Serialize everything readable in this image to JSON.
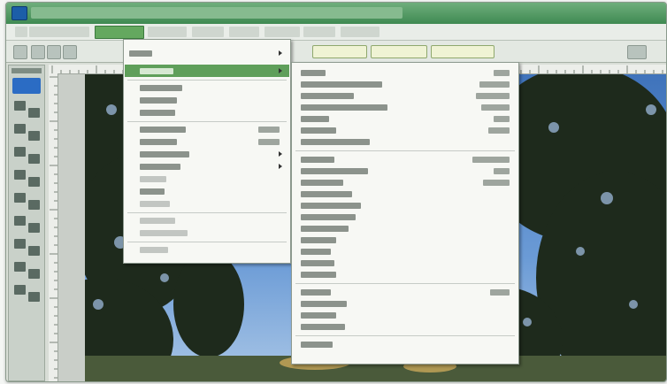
{
  "window": {
    "title": ""
  },
  "menubar": {
    "items": [
      {
        "label": "",
        "active": false
      },
      {
        "label": "",
        "active": false
      },
      {
        "label": "",
        "active": true
      },
      {
        "label": "",
        "active": false
      },
      {
        "label": "",
        "active": false
      },
      {
        "label": "",
        "active": false
      },
      {
        "label": "",
        "active": false
      },
      {
        "label": "",
        "active": false
      },
      {
        "label": "",
        "active": false
      }
    ]
  },
  "optionsbar": {
    "buttons": [
      {
        "label": ""
      },
      {
        "label": ""
      },
      {
        "label": ""
      }
    ]
  },
  "image_menu": {
    "header": {
      "label": ""
    },
    "items": [
      {
        "label": "",
        "shortcut": "",
        "enabled": true,
        "submenu": true,
        "highlighted": true,
        "sep_before": false
      },
      {
        "label": "",
        "shortcut": "",
        "enabled": true,
        "submenu": false,
        "highlighted": false,
        "sep_before": true
      },
      {
        "label": "",
        "shortcut": "",
        "enabled": true,
        "submenu": false,
        "highlighted": false,
        "sep_before": false
      },
      {
        "label": "",
        "shortcut": "",
        "enabled": true,
        "submenu": false,
        "highlighted": false,
        "sep_before": false
      },
      {
        "label": "",
        "shortcut": "",
        "enabled": true,
        "submenu": false,
        "highlighted": false,
        "sep_before": true
      },
      {
        "label": "",
        "shortcut": "",
        "enabled": true,
        "submenu": false,
        "highlighted": false,
        "sep_before": false
      },
      {
        "label": "",
        "shortcut": "",
        "enabled": true,
        "submenu": true,
        "highlighted": false,
        "sep_before": false
      },
      {
        "label": "",
        "shortcut": "",
        "enabled": true,
        "submenu": true,
        "highlighted": false,
        "sep_before": false
      },
      {
        "label": "",
        "shortcut": "",
        "enabled": false,
        "submenu": false,
        "highlighted": false,
        "sep_before": false
      },
      {
        "label": "",
        "shortcut": "",
        "enabled": true,
        "submenu": false,
        "highlighted": false,
        "sep_before": false
      },
      {
        "label": "",
        "shortcut": "",
        "enabled": false,
        "submenu": false,
        "highlighted": false,
        "sep_before": false
      },
      {
        "label": "",
        "shortcut": "",
        "enabled": false,
        "submenu": false,
        "highlighted": false,
        "sep_before": true
      },
      {
        "label": "",
        "shortcut": "",
        "enabled": false,
        "submenu": false,
        "highlighted": false,
        "sep_before": false
      },
      {
        "label": "",
        "shortcut": "",
        "enabled": false,
        "submenu": false,
        "highlighted": false,
        "sep_before": true
      }
    ]
  },
  "adjustments_menu": {
    "items": [
      {
        "label": "",
        "shortcut": "",
        "sep_before": false
      },
      {
        "label": "",
        "shortcut": "",
        "sep_before": false
      },
      {
        "label": "",
        "shortcut": "",
        "sep_before": false
      },
      {
        "label": "",
        "shortcut": "",
        "sep_before": false
      },
      {
        "label": "",
        "shortcut": "",
        "sep_before": false
      },
      {
        "label": "",
        "shortcut": "",
        "sep_before": false
      },
      {
        "label": "",
        "shortcut": "",
        "sep_before": false
      },
      {
        "label": "",
        "shortcut": "",
        "sep_before": true
      },
      {
        "label": "",
        "shortcut": "",
        "sep_before": false
      },
      {
        "label": "",
        "shortcut": "",
        "sep_before": false
      },
      {
        "label": "",
        "shortcut": "",
        "sep_before": false
      },
      {
        "label": "",
        "shortcut": "",
        "sep_before": false
      },
      {
        "label": "",
        "shortcut": "",
        "sep_before": false
      },
      {
        "label": "",
        "shortcut": "",
        "sep_before": false
      },
      {
        "label": "",
        "shortcut": "",
        "sep_before": false
      },
      {
        "label": "",
        "shortcut": "",
        "sep_before": false
      },
      {
        "label": "",
        "shortcut": "",
        "sep_before": false
      },
      {
        "label": "",
        "shortcut": "",
        "sep_before": false
      },
      {
        "label": "",
        "shortcut": "",
        "sep_before": true
      },
      {
        "label": "",
        "shortcut": "",
        "sep_before": false
      },
      {
        "label": "",
        "shortcut": "",
        "sep_before": false
      },
      {
        "label": "",
        "shortcut": "",
        "sep_before": false
      },
      {
        "label": "",
        "shortcut": "",
        "sep_before": true
      }
    ]
  },
  "colors": {
    "titlebar": "#4f9a60",
    "menu_highlight": "#5f9f5a",
    "sky": "#4a7fc4"
  }
}
